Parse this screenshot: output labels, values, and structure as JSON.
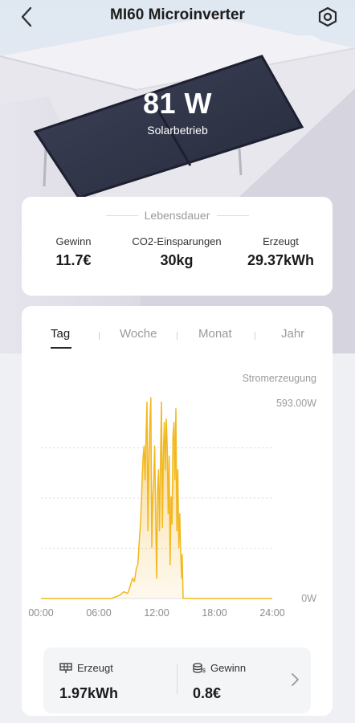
{
  "header": {
    "title": "MI60 Microinverter"
  },
  "hero": {
    "power": "81 W",
    "mode": "Solarbetrieb"
  },
  "lifetime": {
    "title": "Lebensdauer",
    "stats": [
      {
        "label": "Gewinn",
        "value": "11.7€"
      },
      {
        "label": "CO2-Einsparungen",
        "value": "30kg"
      },
      {
        "label": "Erzeugt",
        "value": "29.37kWh"
      }
    ]
  },
  "tabs": [
    {
      "label": "Tag",
      "active": true
    },
    {
      "label": "Woche",
      "active": false
    },
    {
      "label": "Monat",
      "active": false
    },
    {
      "label": "Jahr",
      "active": false
    }
  ],
  "chart_data": {
    "type": "area",
    "title": "Stromerzeugung",
    "xlabel": "",
    "ylabel": "",
    "x_ticks": [
      "00:00",
      "06:00",
      "12:00",
      "18:00",
      "24:00"
    ],
    "y_max_label": "593.00W",
    "y_min_label": "0W",
    "ylim": [
      0,
      593
    ],
    "xlim_hours": [
      0,
      24
    ],
    "grid": true,
    "color": "#f2b81d",
    "series": [
      {
        "x": [
          0,
          7.3,
          8.2,
          8.6,
          9.0,
          9.3,
          9.5,
          9.7,
          9.9,
          10.05,
          10.2,
          10.35,
          10.5,
          10.6,
          10.7,
          10.8,
          10.9,
          11.0,
          11.1,
          11.2,
          11.3,
          11.4,
          11.5,
          11.6,
          11.7,
          11.8,
          11.9,
          12.0,
          12.1,
          12.2,
          12.3,
          12.4,
          12.5,
          12.6,
          12.7,
          12.8,
          12.9,
          13.0,
          13.1,
          13.2,
          13.3,
          13.4,
          13.5,
          13.6,
          13.7,
          13.8,
          13.9,
          14.0,
          14.1,
          14.2,
          14.3,
          14.4,
          14.5,
          14.6,
          14.65,
          14.75,
          15.0,
          24
        ],
        "values": [
          0,
          0,
          10,
          20,
          15,
          40,
          60,
          50,
          90,
          100,
          170,
          230,
          350,
          420,
          450,
          350,
          480,
          580,
          200,
          420,
          520,
          593,
          150,
          300,
          350,
          450,
          250,
          60,
          320,
          380,
          200,
          400,
          580,
          210,
          430,
          520,
          380,
          530,
          450,
          250,
          420,
          100,
          300,
          220,
          480,
          520,
          350,
          560,
          200,
          380,
          150,
          250,
          130,
          60,
          130,
          0,
          0,
          0
        ]
      }
    ]
  },
  "summary": {
    "generated_label": "Erzeugt",
    "generated_value": "1.97kWh",
    "profit_label": "Gewinn",
    "profit_value": "0.8€"
  }
}
